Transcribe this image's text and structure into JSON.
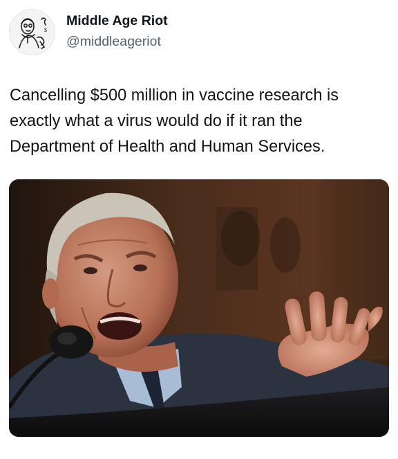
{
  "author": {
    "display_name": "Middle Age Riot",
    "handle": "@middleageriot",
    "avatar_icon": "vintage-cartoon-man-avatar"
  },
  "tweet": {
    "text": "Cancelling $500 million in vaccine research is exactly what a virus would do if it ran the Department of Health and Human Services."
  },
  "media": {
    "icon": "photo-older-man-speaking-at-microphone"
  },
  "colors": {
    "text_primary": "#0f1419",
    "text_secondary": "#536471",
    "background": "#ffffff"
  }
}
